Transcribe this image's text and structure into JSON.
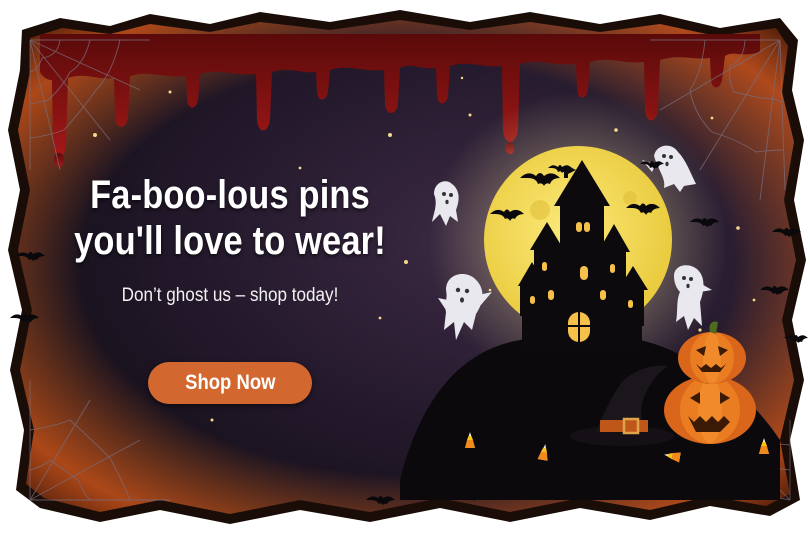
{
  "banner": {
    "headline_line1": "Fa-boo-lous pins",
    "headline_line2": "you'll love to wear!",
    "subheadline": "Don’t ghost us – shop today!",
    "cta_label": "Shop Now"
  },
  "colors": {
    "background": "#1f1622",
    "moon": "#f3dc52",
    "cta": "#d2682f",
    "blood": "#8e1414",
    "pumpkin": "#e97d1c",
    "torn_edge": "#e56a20"
  },
  "icons": [
    "haunted-castle-icon",
    "moon-icon",
    "ghost-icon",
    "bat-icon",
    "pumpkin-icon",
    "witch-hat-icon",
    "candy-corn-icon",
    "spider-web-icon",
    "star-icon"
  ]
}
